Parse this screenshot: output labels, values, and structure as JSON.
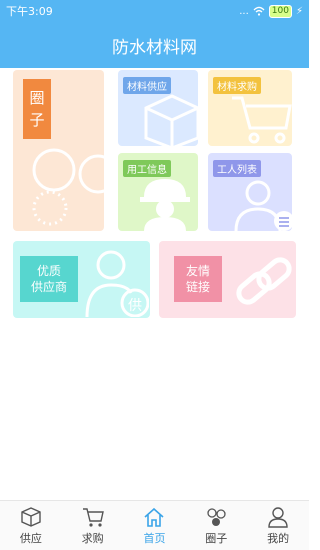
{
  "statusbar": {
    "time": "下午3:09",
    "signal": "...",
    "battery": "100"
  },
  "header": {
    "title": "防水材料网"
  },
  "tiles": {
    "circle": {
      "label_line1": "圈",
      "label_line2": "子"
    },
    "supply": {
      "label": "材料供应"
    },
    "buy": {
      "label": "材料求购"
    },
    "work": {
      "label": "用工信息"
    },
    "workers": {
      "label": "工人列表"
    },
    "quality": {
      "label_line1": "优质",
      "label_line2": "供应商",
      "icon_char": "供"
    },
    "friend": {
      "label_line1": "友情",
      "label_line2": "链接"
    }
  },
  "nav": {
    "items": [
      {
        "label": "供应",
        "icon": "box-icon"
      },
      {
        "label": "求购",
        "icon": "cart-icon"
      },
      {
        "label": "首页",
        "icon": "home-icon",
        "active": true
      },
      {
        "label": "圈子",
        "icon": "circles-icon"
      },
      {
        "label": "我的",
        "icon": "person-icon"
      }
    ]
  },
  "colors": {
    "primary": "#55b6f3",
    "nav_active": "#3aa4e8",
    "circle_badge": "#f1893f",
    "supply_label": "#6fa6ea",
    "buy_label": "#f3c23e",
    "work_label": "#7fc95a",
    "workers_label": "#8f97ea",
    "quality_box": "#57d6cf",
    "friend_box": "#f191a6"
  }
}
